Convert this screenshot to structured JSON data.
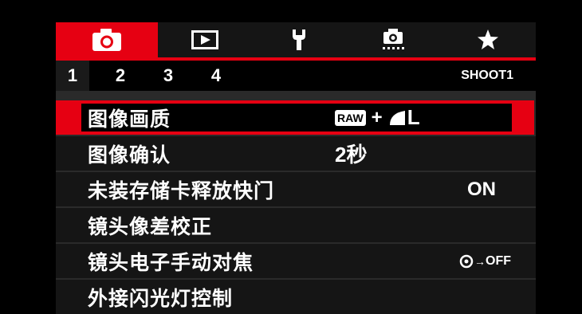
{
  "tabs": [
    {
      "name": "shooting",
      "icon": "camera-icon",
      "active": true
    },
    {
      "name": "playback",
      "icon": "play-icon",
      "active": false
    },
    {
      "name": "setup",
      "icon": "wrench-icon",
      "active": false
    },
    {
      "name": "custom-functions",
      "icon": "custom-camera-icon",
      "active": false
    },
    {
      "name": "my-menu",
      "icon": "star-icon",
      "active": false
    }
  ],
  "subtabs": [
    {
      "label": "1",
      "active": true
    },
    {
      "label": "2",
      "active": false
    },
    {
      "label": "3",
      "active": false
    },
    {
      "label": "4",
      "active": false
    }
  ],
  "page_label": "SHOOT1",
  "menu": {
    "items": [
      {
        "label": "图像画质",
        "value": "",
        "selected": true
      },
      {
        "label": "图像确认",
        "value": "2秒",
        "selected": false
      },
      {
        "label": "未装存储卡释放快门",
        "value": "ON",
        "selected": false
      },
      {
        "label": "镜头像差校正",
        "value": "",
        "selected": false
      },
      {
        "label": "镜头电子手动对焦",
        "value": "",
        "selected": false
      },
      {
        "label": "外接闪光灯控制",
        "value": "",
        "selected": false
      }
    ],
    "quality_value": {
      "raw_badge": "RAW",
      "plus": "+",
      "size": "L"
    },
    "mf_value": {
      "arrow": "→",
      "state": "OFF"
    }
  },
  "colors": {
    "accent": "#e60012",
    "row_bg": "#151515",
    "screen_bg": "#2a2a2a"
  }
}
